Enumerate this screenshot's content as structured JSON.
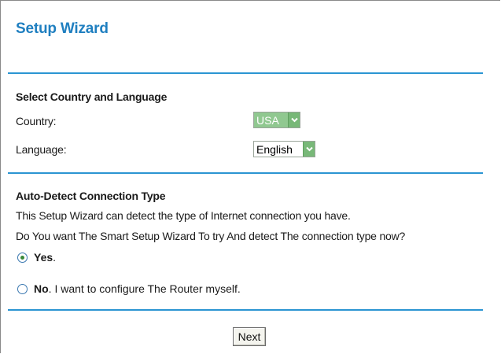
{
  "title": "Setup Wizard",
  "country_section": {
    "heading": "Select Country and Language",
    "country_label": "Country:",
    "country_value": "USA",
    "language_label": "Language:",
    "language_value": "English"
  },
  "detect_section": {
    "heading": "Auto-Detect Connection Type",
    "line1": "This Setup Wizard can detect the type of Internet connection you have.",
    "line2": "Do You want The Smart Setup Wizard To try And detect The connection type now?",
    "options": [
      {
        "strong": "Yes",
        "rest": ".",
        "selected": true
      },
      {
        "strong": "No",
        "rest": ". I want to configure The Router myself.",
        "selected": false
      }
    ]
  },
  "next_label": "Next",
  "colors": {
    "accent": "#1f7fc0",
    "rule": "#2b95d2",
    "select_green": "#78b878"
  },
  "icons": {
    "dropdown": "chevron-down-icon",
    "radio_selected": "radio-checked-icon"
  }
}
